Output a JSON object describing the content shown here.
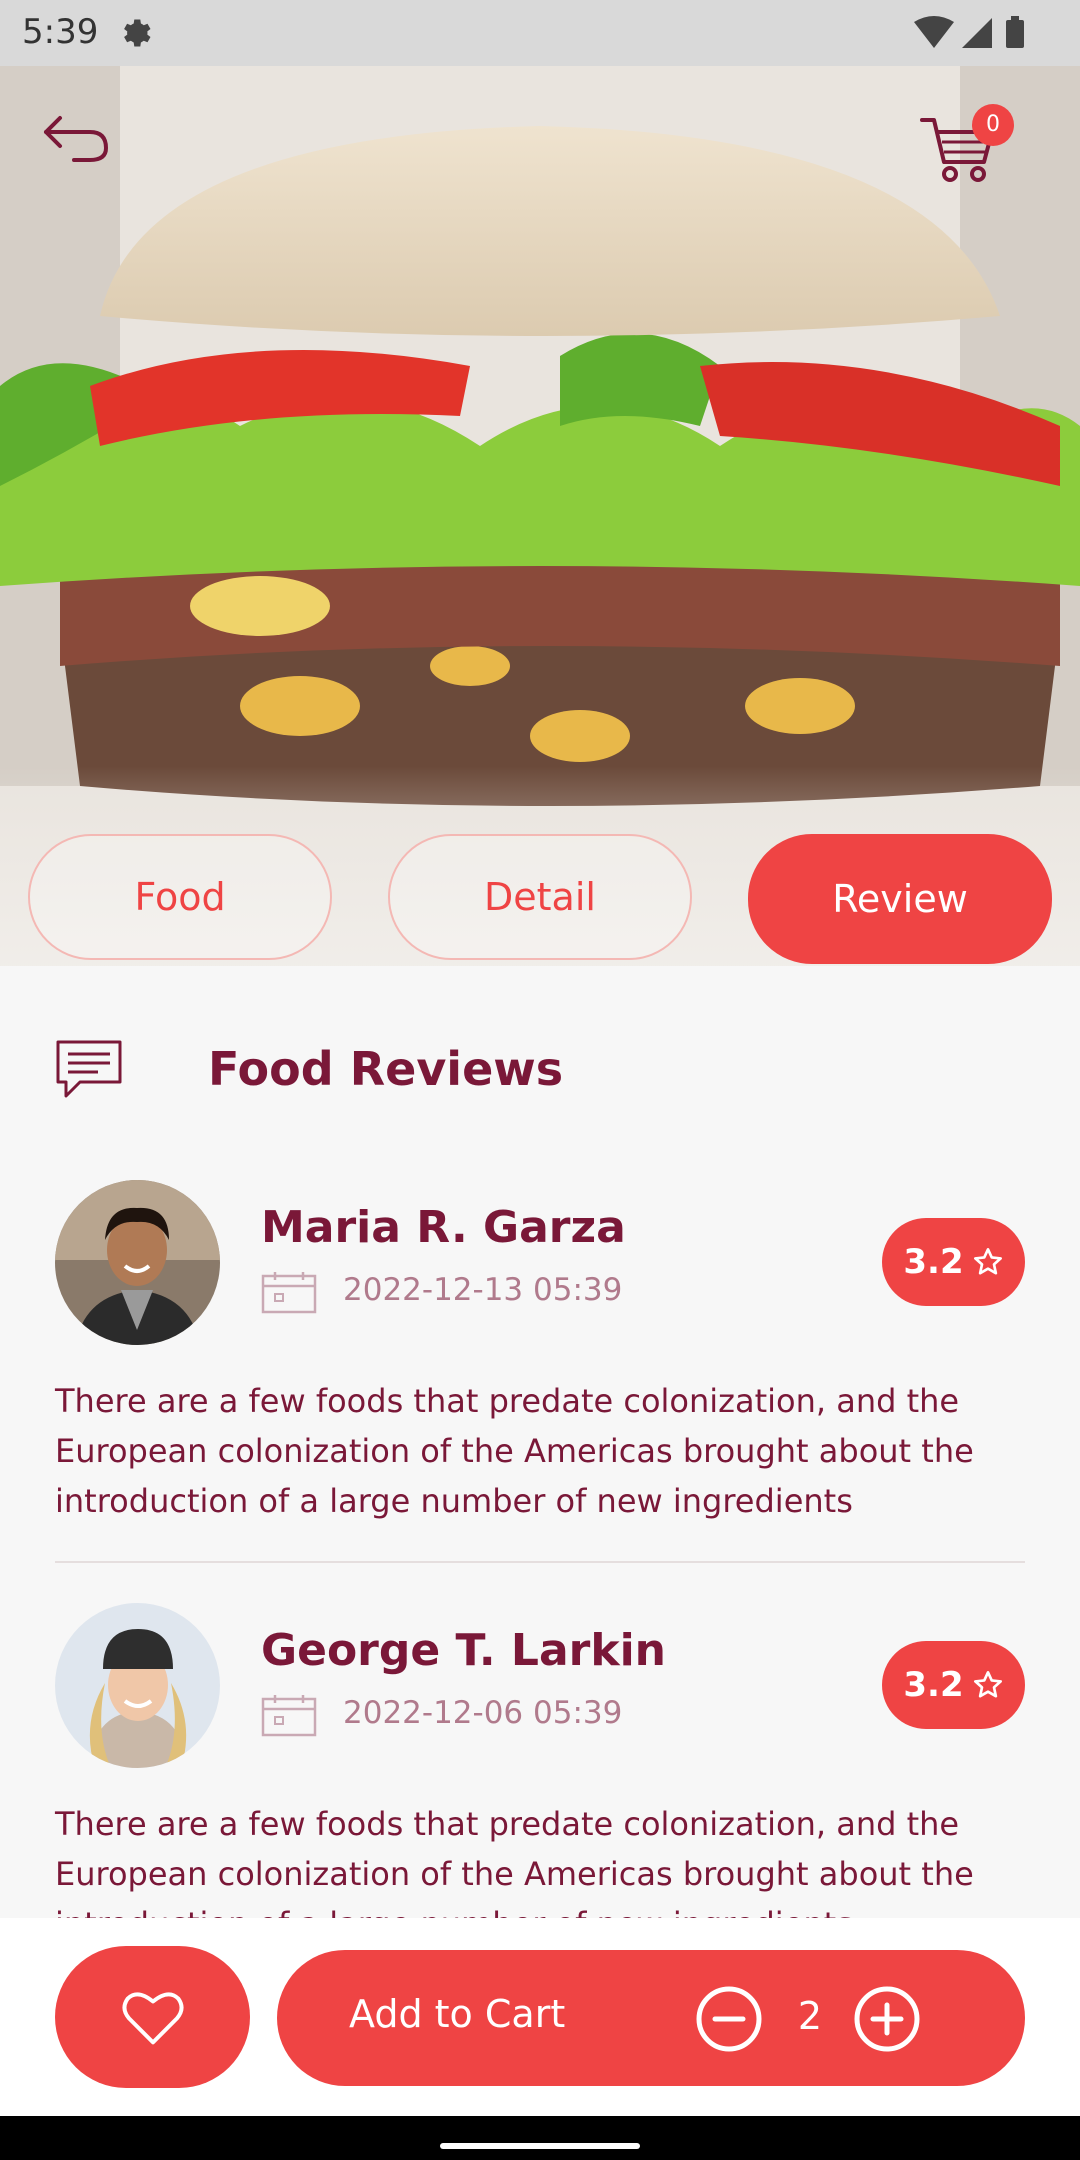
{
  "status_bar": {
    "time": "5:39"
  },
  "header": {
    "cart_count": "0"
  },
  "tabs": [
    {
      "label": "Food",
      "active": false
    },
    {
      "label": "Detail",
      "active": false
    },
    {
      "label": "Review",
      "active": true
    }
  ],
  "section": {
    "title": "Food Reviews",
    "icon": "comment-lines-icon"
  },
  "reviews": [
    {
      "name": "Maria R. Garza",
      "date": "2022-12-13 05:39",
      "rating": "3.2",
      "text": "There are a few foods that predate colonization, and the European colonization of the Americas brought about the introduction of a large number of new ingredients"
    },
    {
      "name": "George T. Larkin",
      "date": "2022-12-06 05:39",
      "rating": "3.2",
      "text": "There are a few foods that predate colonization, and the European colonization of the Americas brought about the introduction of a large number of new ingredients"
    }
  ],
  "bottom_bar": {
    "add_to_cart_label": "Add to Cart",
    "quantity": "2"
  },
  "colors": {
    "accent": "#ef4444",
    "primary_text": "#7a1838",
    "secondary_text": "#b07a8c"
  }
}
